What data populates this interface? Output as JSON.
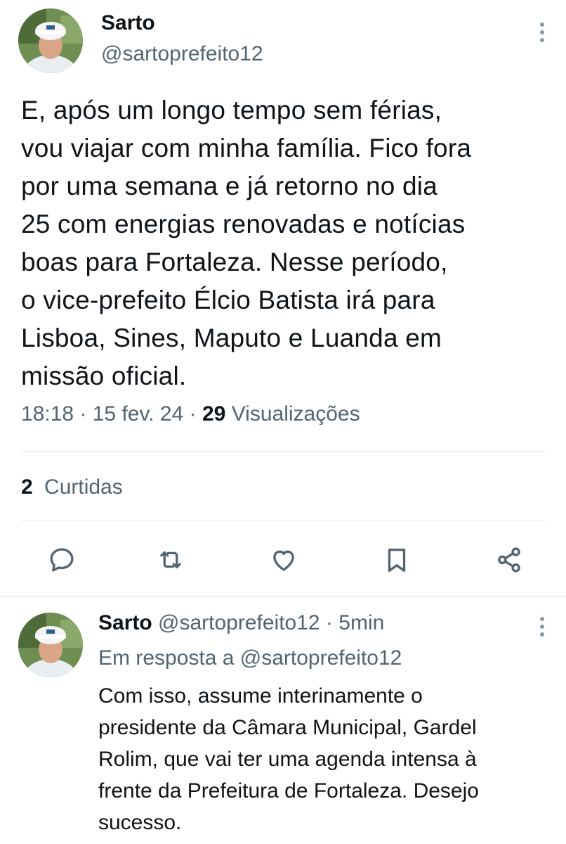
{
  "tweet": {
    "author_name": "Sarto",
    "author_handle": "@sartoprefeito12",
    "text": "E, após um longo tempo sem férias,\nvou viajar com minha família. Fico fora\npor uma semana e já retorno no dia\n25 com energias renovadas e notícias\nboas para Fortaleza. Nesse período,\no vice-prefeito Élcio Batista irá para\nLisboa, Sines, Maputo e Luanda em\nmissão oficial.",
    "time": "18:18",
    "date": "15 fev. 24",
    "views_count": "29",
    "views_label": "Visualizações",
    "likes_count": "2",
    "likes_label": "Curtidas",
    "actions": [
      "reply-icon",
      "retweet-icon",
      "like-icon",
      "bookmark-icon",
      "share-icon"
    ]
  },
  "reply": {
    "author_name": "Sarto",
    "author_handle": "@sartoprefeito12",
    "time": "5min",
    "in_reply_prefix": "Em resposta a",
    "in_reply_handle": "@sartoprefeito12",
    "text": "Com isso, assume interinamente o\npresidente da Câmara Municipal, Gardel\nRolim, que vai ter uma agenda intensa à\nfrente da Prefeitura de Fortaleza. Desejo\nsucesso."
  },
  "colors": {
    "text_primary": "#0f1419",
    "text_secondary": "#536471",
    "divider": "#e6e9ec",
    "icon": "#536471"
  }
}
